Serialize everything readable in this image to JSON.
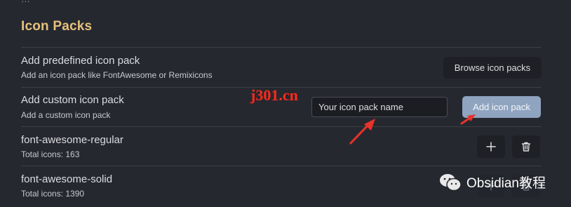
{
  "top_partial_text": "…",
  "section": {
    "title": "Icon Packs"
  },
  "predefined": {
    "name": "Add predefined icon pack",
    "desc": "Add an icon pack like FontAwesome or Remixicons",
    "button_label": "Browse icon packs"
  },
  "custom": {
    "name": "Add custom icon pack",
    "desc": "Add a custom icon pack",
    "input_placeholder": "Your icon pack name",
    "button_label": "Add icon pack"
  },
  "packs": [
    {
      "name": "font-awesome-regular",
      "count": "Total icons: 163"
    },
    {
      "name": "font-awesome-solid",
      "count": "Total icons: 1390"
    }
  ],
  "icons": {
    "add": "plus-icon",
    "delete": "trash-icon"
  },
  "watermark": {
    "text": "j301.cn"
  },
  "wechat_badge": {
    "text": "Obsidian教程",
    "icon": "wechat-icon"
  },
  "colors": {
    "background": "#262830",
    "section_title": "#e5c07b",
    "accent_button": "#8fa4bf",
    "annotation_arrow": "#e8332a"
  }
}
